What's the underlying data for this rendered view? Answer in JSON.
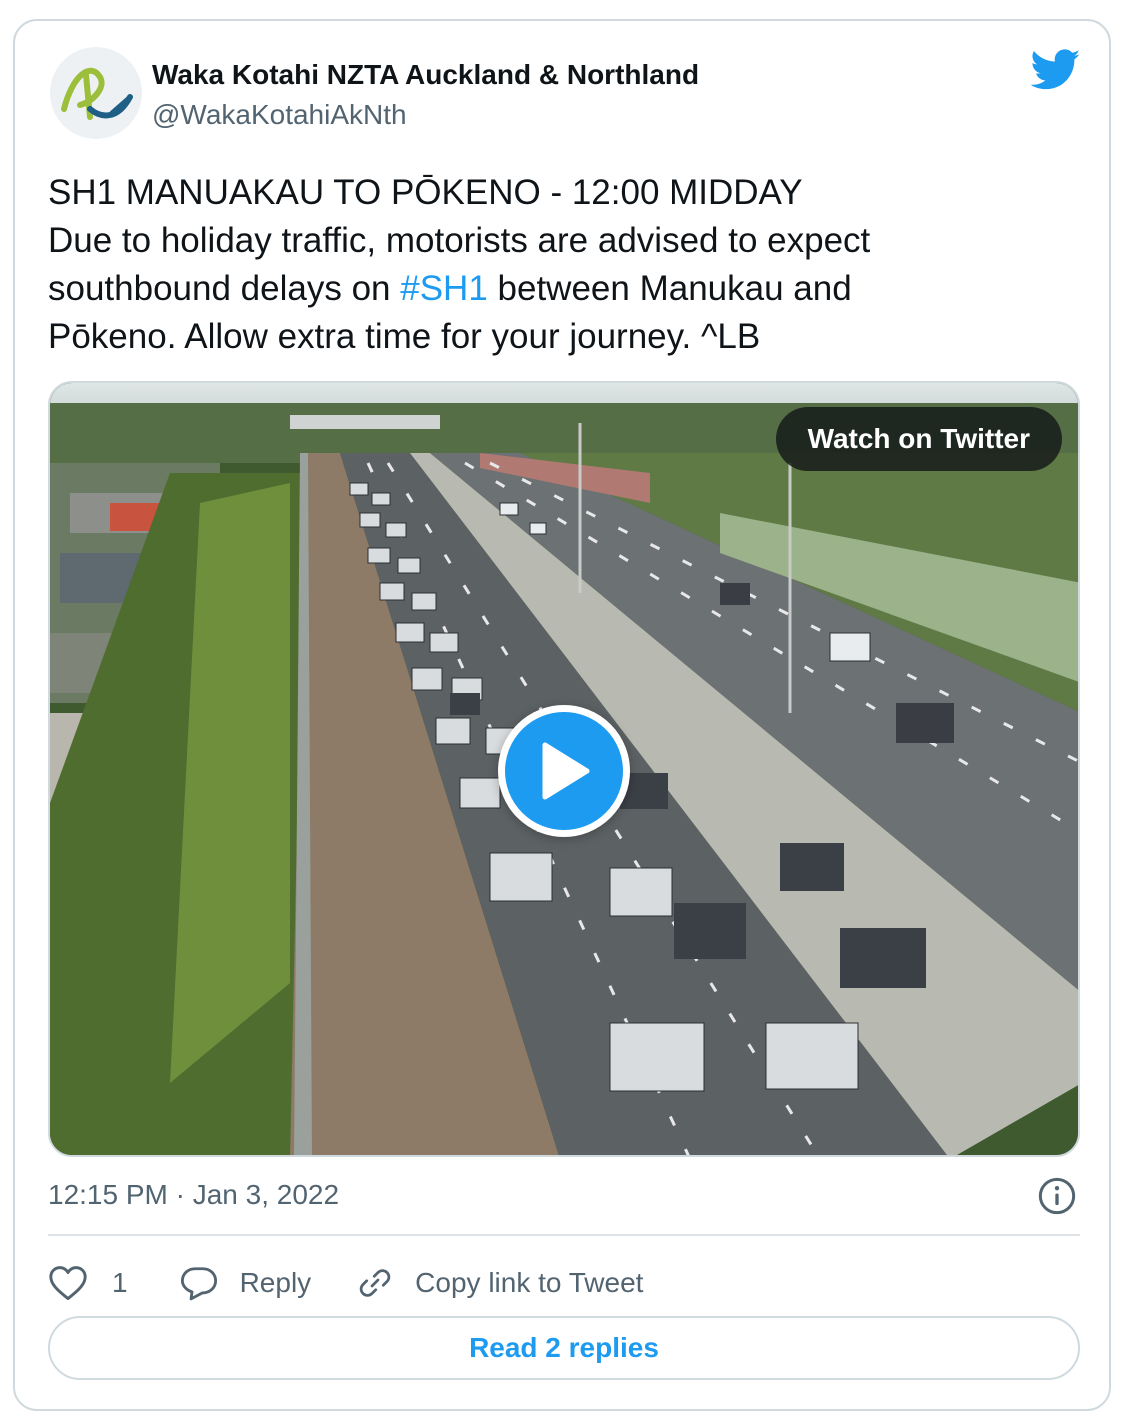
{
  "author": {
    "name": "Waka Kotahi NZTA Auckland & Northland",
    "handle": "@WakaKotahiAkNth"
  },
  "tweet": {
    "line1": "SH1 MANUAKAU TO PŌKENO - 12:00 MIDDAY",
    "line2": "Due to holiday traffic, motorists are advised to expect",
    "line3_pre": "southbound delays on ",
    "hashtag": "#SH1",
    "line3_post": " between Manukau and",
    "line4": "Pōkeno. Allow extra time for your journey. ^LB"
  },
  "media": {
    "watch_label": "Watch on Twitter",
    "play_icon": "play-icon"
  },
  "timestamp": "12:15 PM · Jan 3, 2022",
  "actions": {
    "like_count": "1",
    "reply_label": "Reply",
    "copy_label": "Copy link to Tweet"
  },
  "read_replies_label": "Read 2 replies",
  "icons": {
    "brand": "twitter-bird-icon",
    "info": "info-icon",
    "like": "heart-icon",
    "reply": "speech-bubble-icon",
    "copy": "link-icon"
  },
  "colors": {
    "accent": "#1d9bf0",
    "text": "#0f1419",
    "muted": "#536471",
    "border": "#cfd9de"
  }
}
